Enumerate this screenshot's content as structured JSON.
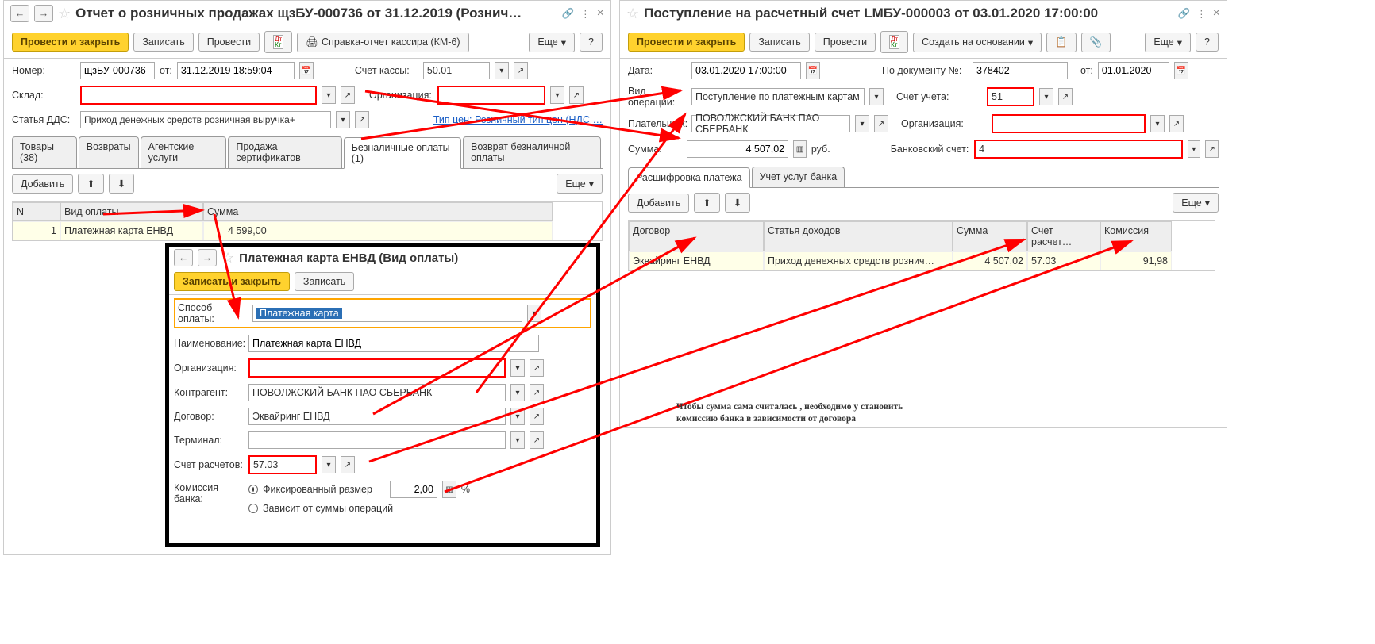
{
  "left": {
    "title": "Отчет о розничных продажах щзБУ-000736 от 31.12.2019 (Рознич…",
    "btn_post_close": "Провести и закрыть",
    "btn_write": "Записать",
    "btn_post": "Провести",
    "btn_report": "Справка-отчет кассира (КМ-6)",
    "btn_more": "Еще",
    "lbl_number": "Номер:",
    "val_number": "щзБУ-000736",
    "lbl_from": "от:",
    "val_date": "31.12.2019 18:59:04",
    "lbl_account": "Счет кассы:",
    "val_account": "50.01",
    "lbl_warehouse": "Склад:",
    "lbl_org": "Организация:",
    "lbl_dds": "Статья ДДС:",
    "val_dds": "Приход денежных средств розничная выручка+",
    "lbl_pricetype": "Тип цен: Розничный тип цен (НДС …",
    "tabs": [
      "Товары (38)",
      "Возвраты",
      "Агентские услуги",
      "Продажа сертификатов",
      "Безналичные оплаты (1)",
      "Возврат безналичной оплаты"
    ],
    "active_tab": 4,
    "btn_add": "Добавить",
    "cols": {
      "n": "N",
      "pay": "Вид оплаты",
      "sum": "Сумма"
    },
    "row": {
      "n": "1",
      "pay": "Платежная карта ЕНВД",
      "sum": "4 599,00"
    }
  },
  "right": {
    "title": "Поступление на расчетный счет LMБУ-000003 от 03.01.2020 17:00:00",
    "btn_post_close": "Провести и закрыть",
    "btn_write": "Записать",
    "btn_post": "Провести",
    "btn_create": "Создать на основании",
    "btn_more": "Еще",
    "lbl_date": "Дата:",
    "val_date": "03.01.2020 17:00:00",
    "lbl_docnum": "По документу №:",
    "val_docnum": "378402",
    "lbl_from": "от:",
    "val_from": "01.01.2020",
    "lbl_op": "Вид операции:",
    "val_op": "Поступление по платежным картам",
    "lbl_acc": "Счет учета:",
    "val_acc": "51",
    "lbl_payer": "Плательщик:",
    "val_payer": "ПОВОЛЖСКИЙ БАНК ПАО СБЕРБАНК",
    "lbl_org": "Организация:",
    "lbl_sum": "Сумма:",
    "val_sum": "4 507,02",
    "cur": "руб.",
    "lbl_bank": "Банковский счет:",
    "val_bank": "4",
    "tabs": [
      "Расшифровка платежа",
      "Учет услуг банка"
    ],
    "active_tab": 0,
    "btn_add": "Добавить",
    "cols": {
      "contract": "Договор",
      "income": "Статья доходов",
      "sum": "Сумма",
      "acc": "Счет расчет…",
      "comm": "Комиссия"
    },
    "row": {
      "contract": "Эквайринг ЕНВД",
      "income": "Приход денежных средств рознич…",
      "sum": "4 507,02",
      "acc": "57.03",
      "comm": "91,98"
    }
  },
  "modal": {
    "title": "Платежная карта ЕНВД (Вид оплаты)",
    "btn_save_close": "Записать и закрыть",
    "btn_write": "Записать",
    "lbl_method": "Способ оплаты:",
    "val_method": "Платежная карта",
    "lbl_name": "Наименование:",
    "val_name": "Платежная карта ЕНВД",
    "lbl_org": "Организация:",
    "lbl_counter": "Контрагент:",
    "val_counter": "ПОВОЛЖСКИЙ БАНК ПАО СБЕРБАНК",
    "lbl_contract": "Договор:",
    "val_contract": "Эквайринг ЕНВД",
    "lbl_terminal": "Терминал:",
    "lbl_settle": "Счет расчетов:",
    "val_settle": "57.03",
    "lbl_comm": "Комиссия банка:",
    "opt_fixed": "Фиксированный размер",
    "val_fixed": "2,00",
    "pct": "%",
    "opt_dep": "Зависит от суммы операций"
  },
  "note": "Чтобы сумма сама считалась , необходимо у становить комиссию банка в зависимости от договора"
}
